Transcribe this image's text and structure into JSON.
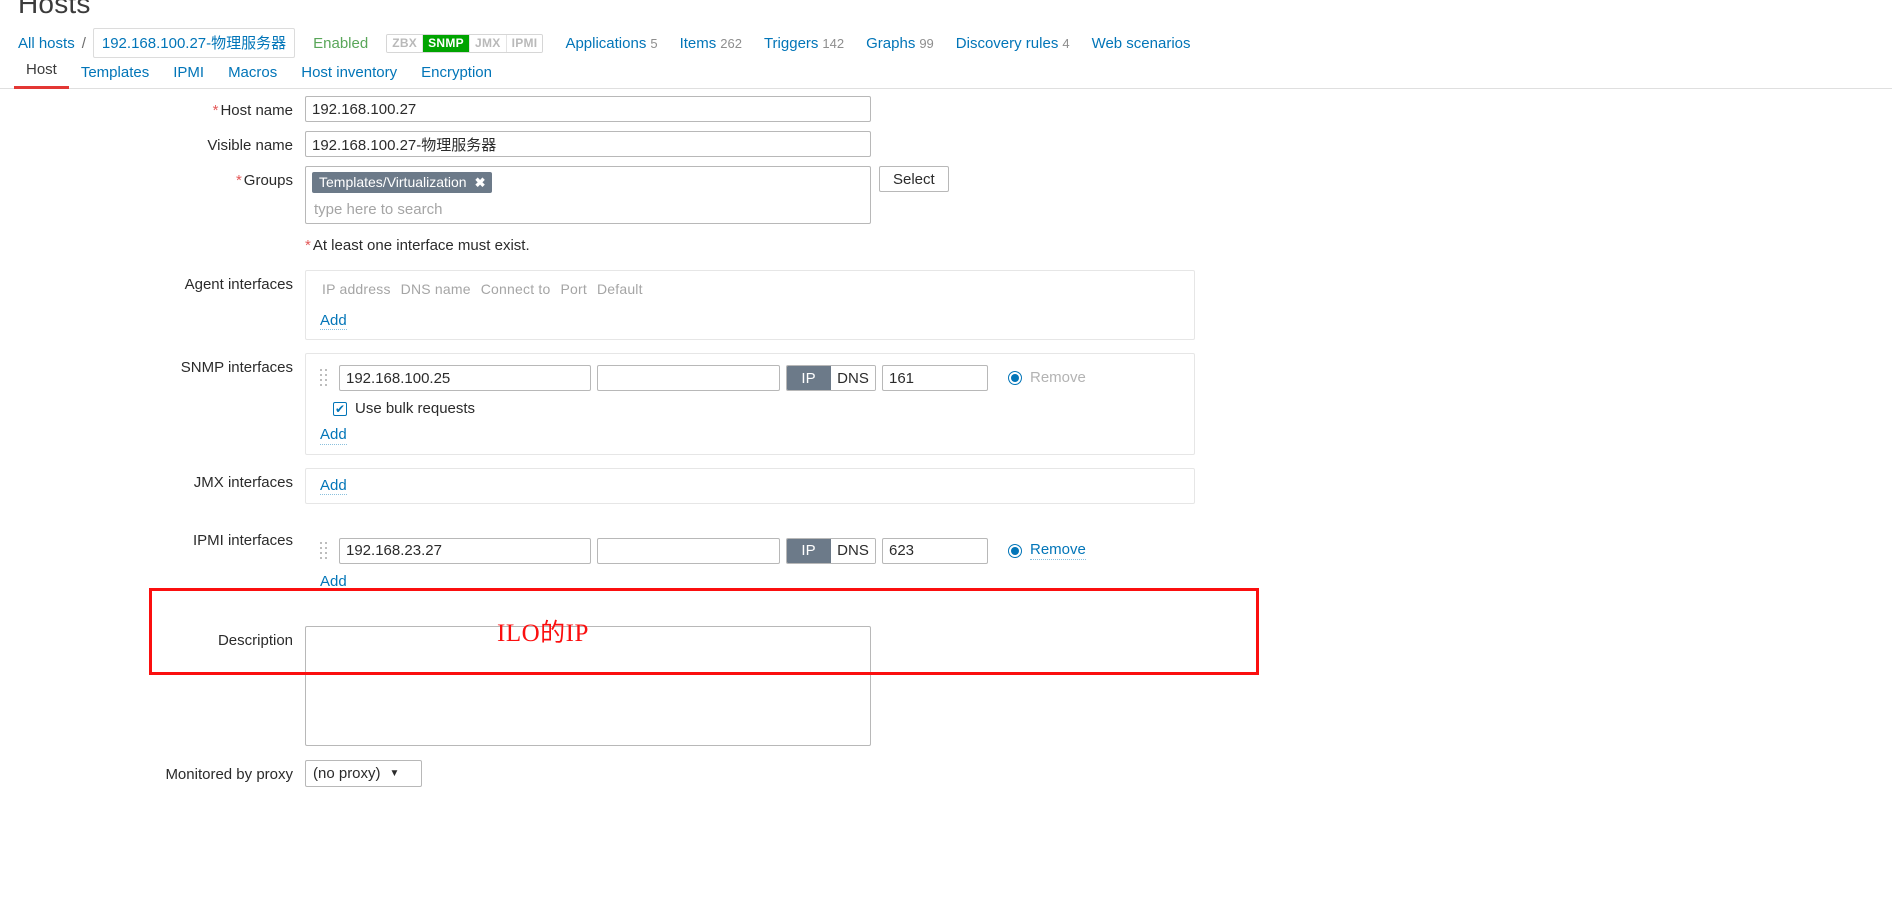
{
  "page": {
    "title": "Hosts"
  },
  "breadcrumb": {
    "all_hosts": "All hosts",
    "separator": "/",
    "host": "192.168.100.27-物理服务器",
    "status": "Enabled"
  },
  "protocols": [
    {
      "label": "ZBX",
      "active": false
    },
    {
      "label": "SNMP",
      "active": true
    },
    {
      "label": "JMX",
      "active": false
    },
    {
      "label": "IPMI",
      "active": false
    }
  ],
  "header_links": [
    {
      "label": "Applications",
      "count": "5"
    },
    {
      "label": "Items",
      "count": "262"
    },
    {
      "label": "Triggers",
      "count": "142"
    },
    {
      "label": "Graphs",
      "count": "99"
    },
    {
      "label": "Discovery rules",
      "count": "4"
    },
    {
      "label": "Web scenarios",
      "count": ""
    }
  ],
  "tabs": [
    {
      "label": "Host",
      "selected": true
    },
    {
      "label": "Templates",
      "selected": false
    },
    {
      "label": "IPMI",
      "selected": false
    },
    {
      "label": "Macros",
      "selected": false
    },
    {
      "label": "Host inventory",
      "selected": false
    },
    {
      "label": "Encryption",
      "selected": false
    }
  ],
  "form": {
    "host_name": {
      "label": "Host name",
      "required": true,
      "value": "192.168.100.27"
    },
    "visible_name": {
      "label": "Visible name",
      "required": false,
      "value": "192.168.100.27-物理服务器"
    },
    "groups": {
      "label": "Groups",
      "required": true,
      "chips": [
        "Templates/Virtualization"
      ],
      "chip_remove": "✖",
      "placeholder": "type here to search",
      "select_button": "Select"
    },
    "interface_note": "At least one interface must exist.",
    "agent_interfaces": {
      "label": "Agent interfaces",
      "columns": [
        "IP address",
        "DNS name",
        "Connect to",
        "Port",
        "Default"
      ],
      "add_label": "Add",
      "rows": []
    },
    "snmp_interfaces": {
      "label": "SNMP interfaces",
      "add_label": "Add",
      "bulk_label": "Use bulk requests",
      "bulk_checked": true,
      "bulk_mark": "✔",
      "rows": [
        {
          "ip": "192.168.100.25",
          "dns": "",
          "connect_to": "IP",
          "ip_label": "IP",
          "dns_label": "DNS",
          "port": "161",
          "default_checked": true,
          "remove_label": "Remove",
          "remove_disabled": true
        }
      ]
    },
    "jmx_interfaces": {
      "label": "JMX interfaces",
      "add_label": "Add",
      "rows": []
    },
    "ipmi_interfaces": {
      "label": "IPMI interfaces",
      "add_label": "Add",
      "rows": [
        {
          "ip": "192.168.23.27",
          "dns": "",
          "connect_to": "IP",
          "ip_label": "IP",
          "dns_label": "DNS",
          "port": "623",
          "default_checked": true,
          "remove_label": "Remove",
          "remove_disabled": false
        }
      ]
    },
    "description": {
      "label": "Description",
      "value": ""
    },
    "monitored_by_proxy": {
      "label": "Monitored by proxy",
      "value": "(no proxy)",
      "caret": "▼"
    }
  },
  "annotation": {
    "text": "ILO的IP",
    "color": "#fb0f0f"
  }
}
